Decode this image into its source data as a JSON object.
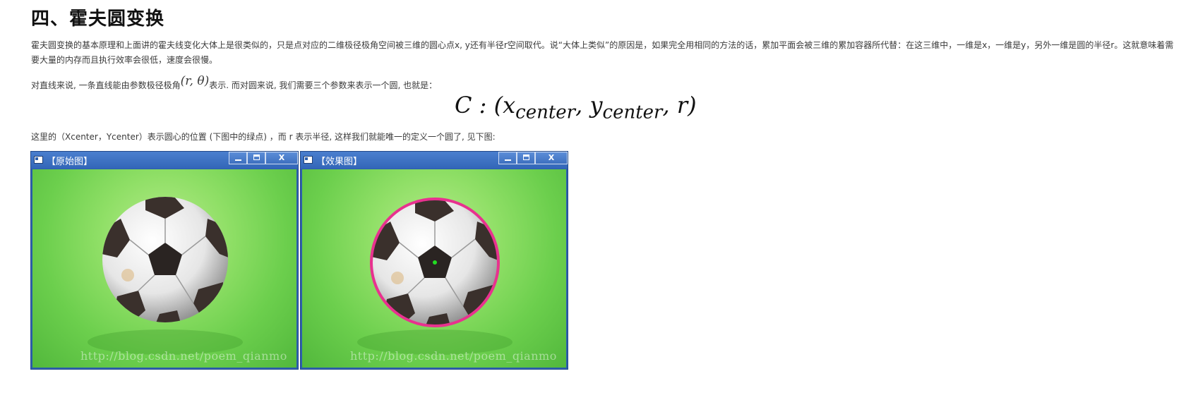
{
  "heading": "四、霍夫圆变换",
  "paragraph1": "霍夫圆变换的基本原理和上面讲的霍夫线变化大体上是很类似的，只是点对应的二维极径极角空间被三维的圆心点x, y还有半径r空间取代。说“大体上类似”的原因是，如果完全用相同的方法的话，累加平面会被三维的累加容器所代替：在这三维中，一维是x，一维是y，另外一维是圆的半径r。这就意味着需要大量的内存而且执行效率会很低，速度会很慢。",
  "paragraph2": {
    "before": "对直线来说, 一条直线能由参数极径极角",
    "math": "(r, θ)",
    "after": "表示. 而对圆来说, 我们需要三个参数来表示一个圆, 也就是："
  },
  "formula": {
    "lhs": "C : (x",
    "sub1": "center",
    "mid": ", y",
    "sub2": "center",
    "rhs": ", r)"
  },
  "paragraph3": "这里的（Xcenter，Ycenter）表示圆心的位置 (下图中的绿点) ，而 r 表示半径, 这样我们就能唯一的定义一个圆了, 见下图:",
  "windows": {
    "original": {
      "title": "【原始图】",
      "close": "X",
      "watermark": "http://blog.csdn.net/poem_qianmo"
    },
    "result": {
      "title": "【效果图】",
      "close": "X",
      "watermark": "http://blog.csdn.net/poem_qianmo"
    }
  },
  "colors": {
    "titlebar": "#3366b8",
    "detected_circle": "#e8318f",
    "center_point": "#22dd22"
  }
}
